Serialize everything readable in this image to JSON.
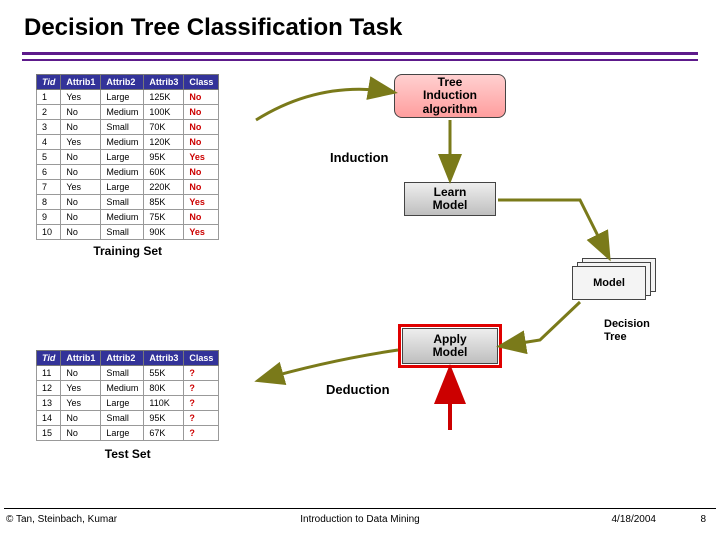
{
  "title": "Decision Tree Classification Task",
  "labels": {
    "training_set": "Training Set",
    "test_set": "Test Set",
    "induction": "Induction",
    "deduction": "Deduction",
    "decision_tree": "Decision\nTree",
    "model": "Model"
  },
  "nodes": {
    "algorithm_l1": "Tree",
    "algorithm_l2": "Induction",
    "algorithm_l3": "algorithm",
    "learn_l1": "Learn",
    "learn_l2": "Model",
    "apply_l1": "Apply",
    "apply_l2": "Model"
  },
  "table_headers": {
    "tid": "Tid",
    "a1": "Attrib1",
    "a2": "Attrib2",
    "a3": "Attrib3",
    "cls": "Class"
  },
  "training_rows": [
    {
      "tid": "1",
      "a1": "Yes",
      "a2": "Large",
      "a3": "125K",
      "cls": "No"
    },
    {
      "tid": "2",
      "a1": "No",
      "a2": "Medium",
      "a3": "100K",
      "cls": "No"
    },
    {
      "tid": "3",
      "a1": "No",
      "a2": "Small",
      "a3": "70K",
      "cls": "No"
    },
    {
      "tid": "4",
      "a1": "Yes",
      "a2": "Medium",
      "a3": "120K",
      "cls": "No"
    },
    {
      "tid": "5",
      "a1": "No",
      "a2": "Large",
      "a3": "95K",
      "cls": "Yes"
    },
    {
      "tid": "6",
      "a1": "No",
      "a2": "Medium",
      "a3": "60K",
      "cls": "No"
    },
    {
      "tid": "7",
      "a1": "Yes",
      "a2": "Large",
      "a3": "220K",
      "cls": "No"
    },
    {
      "tid": "8",
      "a1": "No",
      "a2": "Small",
      "a3": "85K",
      "cls": "Yes"
    },
    {
      "tid": "9",
      "a1": "No",
      "a2": "Medium",
      "a3": "75K",
      "cls": "No"
    },
    {
      "tid": "10",
      "a1": "No",
      "a2": "Small",
      "a3": "90K",
      "cls": "Yes"
    }
  ],
  "test_rows": [
    {
      "tid": "11",
      "a1": "No",
      "a2": "Small",
      "a3": "55K",
      "cls": "?"
    },
    {
      "tid": "12",
      "a1": "Yes",
      "a2": "Medium",
      "a3": "80K",
      "cls": "?"
    },
    {
      "tid": "13",
      "a1": "Yes",
      "a2": "Large",
      "a3": "110K",
      "cls": "?"
    },
    {
      "tid": "14",
      "a1": "No",
      "a2": "Small",
      "a3": "95K",
      "cls": "?"
    },
    {
      "tid": "15",
      "a1": "No",
      "a2": "Large",
      "a3": "67K",
      "cls": "?"
    }
  ],
  "footer": {
    "authors": "© Tan, Steinbach, Kumar",
    "course": "Introduction to Data Mining",
    "date": "4/18/2004",
    "page": "8"
  }
}
